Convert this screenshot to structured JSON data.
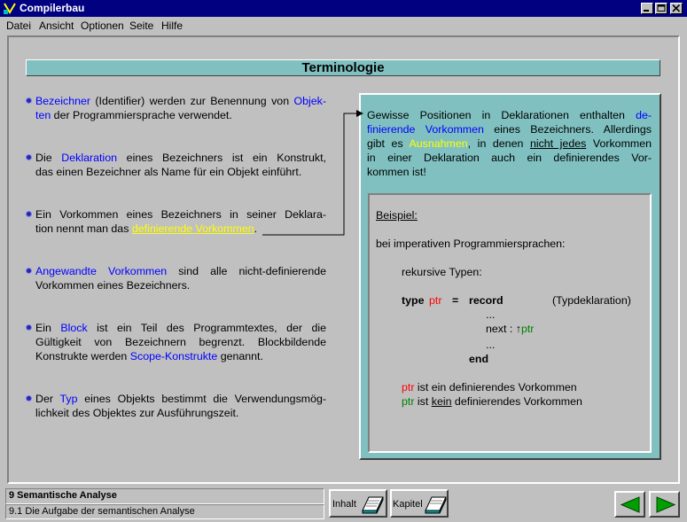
{
  "window": {
    "title": "Compilerbau"
  },
  "menu": [
    "Datei",
    "Ansicht",
    "Optionen",
    "Seite",
    "Hilfe"
  ],
  "page_title": "Terminologie",
  "left": {
    "p1": {
      "a": "Bezeichner",
      "b": " (Identifier) werden zur Benennung von ",
      "c": "Objek-",
      "d": "ten",
      "e": " der Programmiersprache verwendet."
    },
    "p2": {
      "a": "Die ",
      "b": "Deklaration",
      "c": " eines Bezeichners ist ein Konstrukt,",
      "d": "das  einen Bezeichner als Name für ein Objekt einführt."
    },
    "p3": {
      "a": "Ein Vorkommen eines Bezeichners in seiner Deklara-",
      "b": "tion nennt man das ",
      "c": "definierende Vorkommen",
      "d": "."
    },
    "p4": {
      "a": "Angewandte Vorkommen",
      "b": " sind alle nicht-definierende",
      "c": "Vorkommen eines Bezeichners."
    },
    "p5": {
      "a": "Ein ",
      "b": "Block",
      "c": " ist ein Teil des Programmtextes, der die",
      "d": "Gültigkeit von Bezeichnern begrenzt. Blockbildende",
      "e": "Konstrukte werden ",
      "f": "Scope-Konstrukte",
      "g": " genannt."
    },
    "p6": {
      "a": "Der ",
      "b": "Typ",
      "c": " eines Objekts bestimmt die Verwendungsmög-",
      "d": "lichkeit des Objektes zur Ausführungszeit."
    }
  },
  "right": {
    "l1a": "Gewisse Positionen in Deklarationen enthalten ",
    "l1b": "de-",
    "l2a": "finierende Vorkommen",
    "l2b": " eines Bezeichners. Allerdings",
    "l3a": "gibt es ",
    "l3b": "Ausnahmen",
    "l3c": ", in denen ",
    "l3d": "nicht jedes",
    "l3e": " Vorkommen",
    "l4": "in einer Deklaration auch ein definierendes Vor-",
    "l5": "kommen ist!"
  },
  "example": {
    "heading": "Beispiel:",
    "line1": "bei imperativen Programmiersprachen:",
    "line2": "rekursive Typen:",
    "kw_type": "type",
    "ptr": "ptr",
    "eq": "=",
    "kw_record": "record",
    "comment": "(Typdeklaration)",
    "dots1": "...",
    "next": "next : ",
    "arrow": "↑",
    "dots2": "...",
    "kw_end": "end",
    "note1a": "ptr",
    "note1b": " ist ein definierendes Vorkommen",
    "note2a": "ptr",
    "note2b": " ist ",
    "note2c": "kein",
    "note2d": " definierendes Vorkommen"
  },
  "status": {
    "chapter": "9 Semantische Analyse",
    "section": "9.1 Die Aufgabe der semantischen Analyse",
    "btn_inhalt": "Inhalt",
    "btn_kapitel": "Kapitel"
  },
  "colors": {
    "titlebar": "#000080",
    "panel": "#80c0c0",
    "link": "#0000ff",
    "highlight": "#ffff00",
    "nav_green": "#008000"
  }
}
